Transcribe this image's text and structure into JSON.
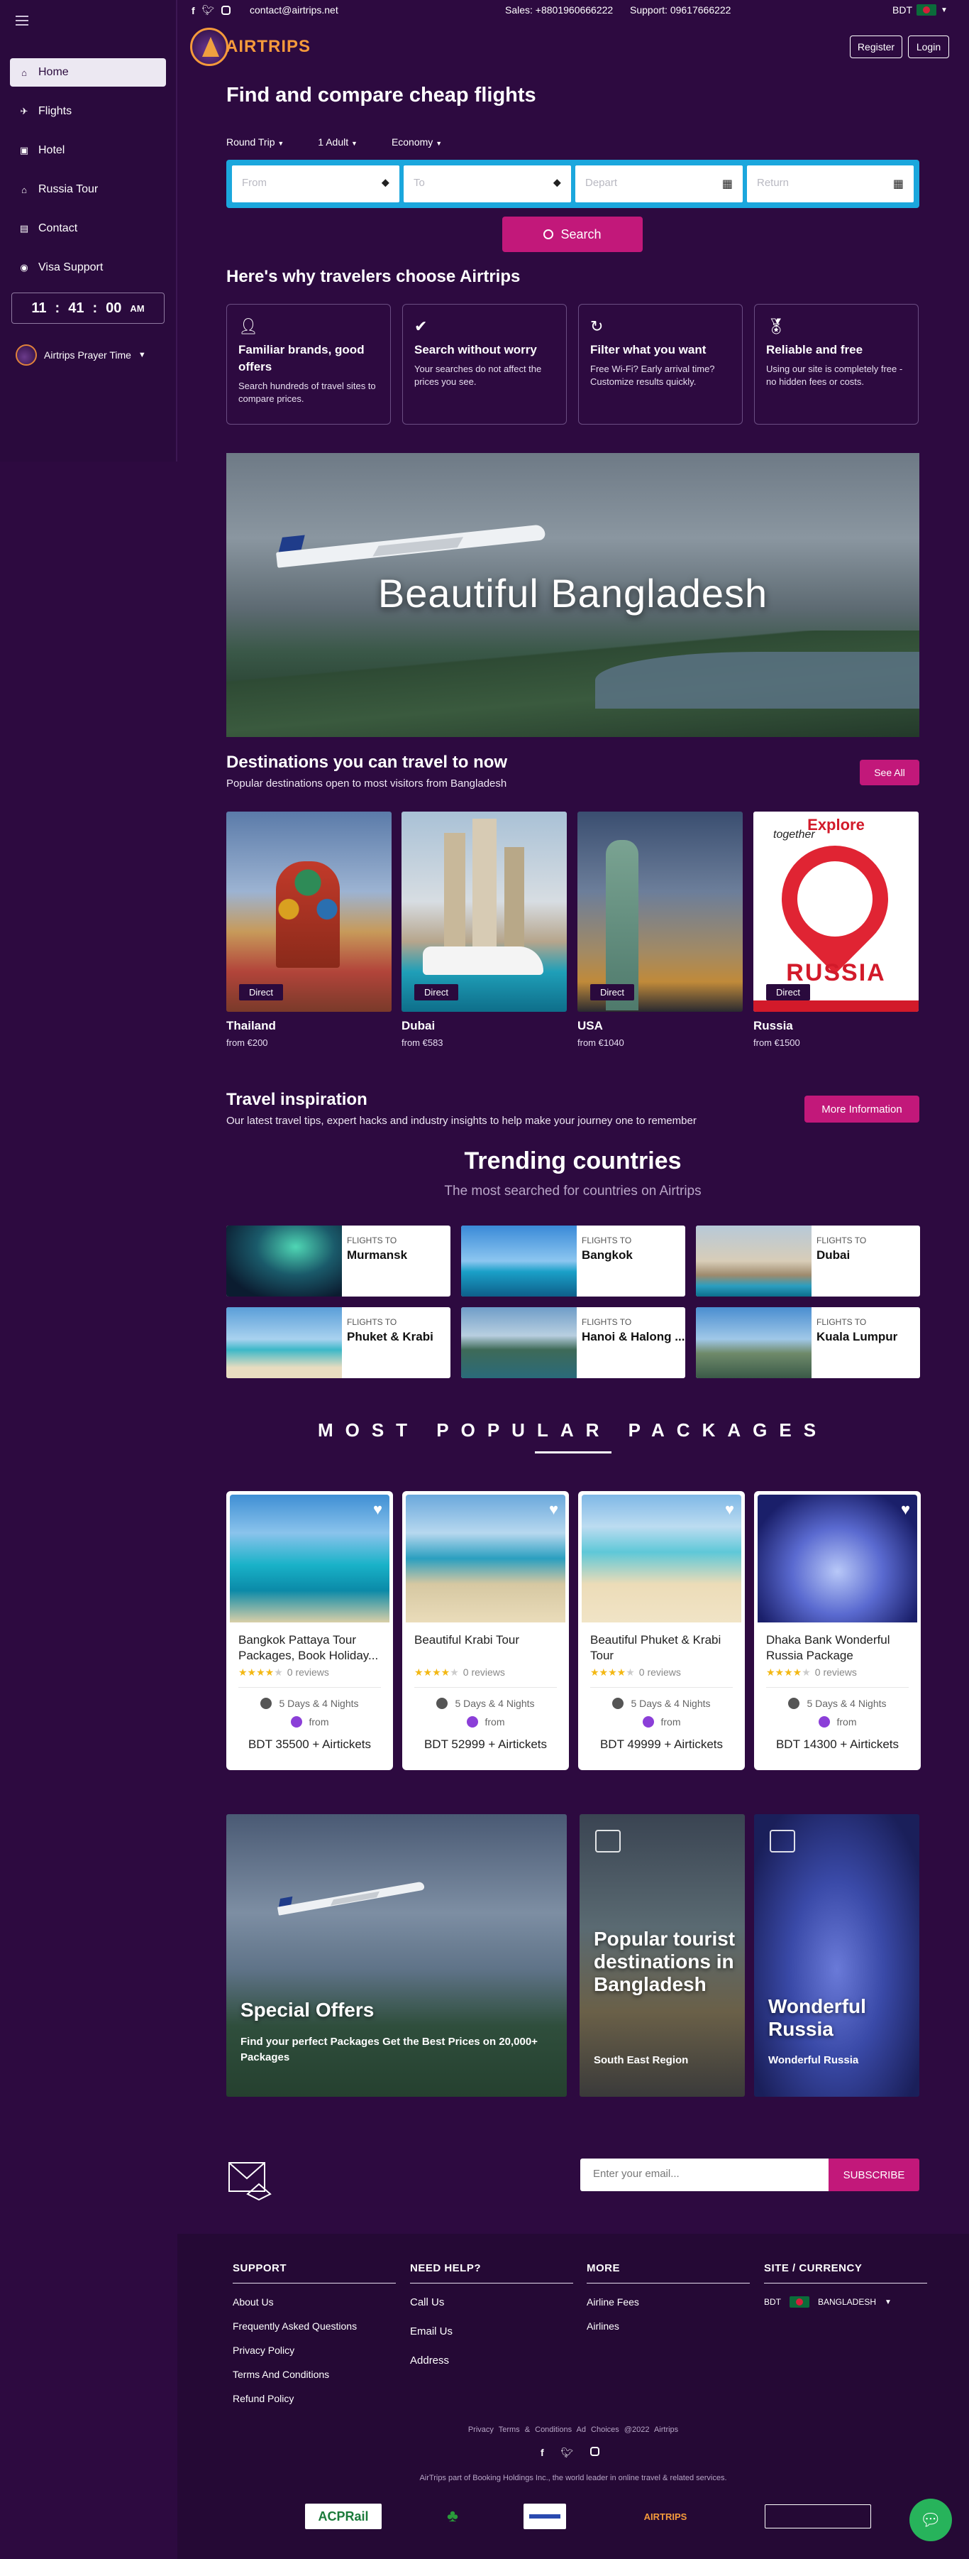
{
  "topbar": {
    "email": "contact@airtrips.net",
    "sales": "Sales: +8801960666222",
    "support": "Support: 09617666222",
    "currency": "BDT"
  },
  "logo": {
    "wordmark": "AIRTRIPS"
  },
  "auth": {
    "register": "Register",
    "login": "Login"
  },
  "sidebar": {
    "items": [
      {
        "label": "Home",
        "icon": "home-icon",
        "active": true
      },
      {
        "label": "Flights",
        "icon": "plane-icon"
      },
      {
        "label": "Hotel",
        "icon": "hotel-icon"
      },
      {
        "label": "Russia Tour",
        "icon": "house-icon"
      },
      {
        "label": "Contact",
        "icon": "contact-icon"
      },
      {
        "label": "Visa Support",
        "icon": "globe-icon"
      }
    ],
    "clock": {
      "h": "11",
      "m": "41",
      "s": "00",
      "ampm": "AM"
    },
    "prayer": "Airtrips Prayer Time"
  },
  "search": {
    "heading": "Find and compare cheap flights",
    "trip_type": "Round Trip",
    "passengers": "1 Adult",
    "cabin": "Economy",
    "from_placeholder": "From",
    "to_placeholder": "To",
    "depart_placeholder": "Depart",
    "return_placeholder": "Return",
    "button": "Search"
  },
  "why": {
    "heading": "Here's why travelers choose Airtrips",
    "cards": [
      {
        "title": "Familiar brands, good offers",
        "text": "Search hundreds of travel sites to compare prices.",
        "icon": "user-plus-icon"
      },
      {
        "title": "Search without worry",
        "text": "Your searches do not affect the prices you see.",
        "icon": "check-circle-icon"
      },
      {
        "title": "Filter what you want",
        "text": "Free Wi-Fi? Early arrival time? Customize results quickly.",
        "icon": "refresh-icon"
      },
      {
        "title": "Reliable and free",
        "text": "Using our site is completely free - no hidden fees or costs.",
        "icon": "medal-icon"
      }
    ]
  },
  "hero": {
    "title": "Beautiful Bangladesh"
  },
  "destinations": {
    "heading": "Destinations you can travel to now",
    "subtitle": "Popular destinations open to most visitors from Bangladesh",
    "see_all": "See All",
    "tag": "Direct",
    "items": [
      {
        "name": "Thailand",
        "price": "from €200"
      },
      {
        "name": "Dubai",
        "price": "from €583"
      },
      {
        "name": "USA",
        "price": "from €1040"
      },
      {
        "name": "Russia",
        "price": "from €1500"
      }
    ],
    "russia_poster": {
      "top": "Explore",
      "script": "together",
      "bottom": "RUSSIA"
    }
  },
  "inspiration": {
    "heading": "Travel inspiration",
    "subtitle": "Our latest travel tips, expert hacks and industry insights to help make your journey one to remember",
    "button": "More Information"
  },
  "trending": {
    "heading": "Trending countries",
    "subtitle": "The most searched for countries on Airtrips",
    "label": "FLIGHTS TO",
    "items": [
      "Murmansk",
      "Bangkok",
      "Dubai",
      "Phuket & Krabi",
      "Hanoi & Halong ...",
      "Kuala Lumpur"
    ]
  },
  "packages": {
    "heading": "MOST POPULAR PACKAGES",
    "reviews": "0 reviews",
    "duration": "5 Days & 4 Nights",
    "from": "from",
    "items": [
      {
        "title": "Bangkok Pattaya Tour Packages, Book Holiday...",
        "price": "BDT 35500 + Airtickets"
      },
      {
        "title": "Beautiful Krabi Tour",
        "price": "BDT 52999 + Airtickets"
      },
      {
        "title": "Beautiful Phuket & Krabi Tour",
        "price": "BDT 49999 + Airtickets"
      },
      {
        "title": "Dhaka Bank Wonderful Russia Package",
        "price": "BDT 14300 + Airtickets"
      }
    ]
  },
  "promos": [
    {
      "title": "Special Offers",
      "sub": "Find your perfect Packages Get the Best Prices on 20,000+ Packages"
    },
    {
      "title": "Popular tourist destinations in Bangladesh",
      "sub": "South East Region"
    },
    {
      "title": "Wonderful Russia",
      "sub": "Wonderful Russia"
    }
  ],
  "newsletter": {
    "placeholder": "Enter your email...",
    "button": "SUBSCRIBE"
  },
  "footer": {
    "support": {
      "title": "SUPPORT",
      "links": [
        "About Us",
        "Frequently Asked Questions",
        "Privacy Policy",
        "Terms And Conditions",
        "Refund Policy"
      ]
    },
    "help": {
      "title": "NEED HELP?",
      "links": [
        "Call Us",
        "Email Us",
        "Address"
      ]
    },
    "more": {
      "title": "MORE",
      "links": [
        "Airline Fees",
        "Airlines"
      ]
    },
    "site": {
      "title": "SITE / CURRENCY",
      "currency": "BDT",
      "country": "BANGLADESH"
    },
    "legal": "Privacy   Terms & Conditions   Ad Choices   @2022 Airtrips",
    "tagline": "AirTrips part of Booking Holdings Inc., the world leader in online travel & related services.",
    "partners": [
      "ACPRail",
      "",
      "",
      "AIRTRIPS"
    ]
  },
  "colors": {
    "bg": "#2d0a40",
    "accent": "#c2187a",
    "search_frame": "#1ba7dd",
    "chat": "#27b35b"
  }
}
